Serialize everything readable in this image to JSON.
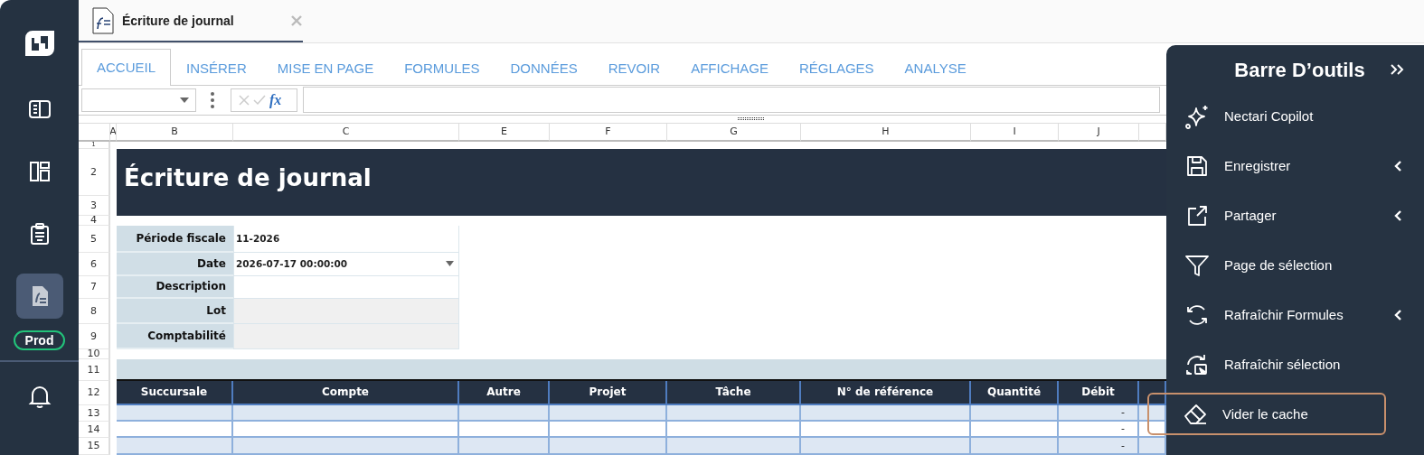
{
  "sidebar": {
    "items": [
      {
        "kind": "panel",
        "selected": false
      },
      {
        "kind": "dashboard",
        "selected": false
      },
      {
        "kind": "clipboard",
        "selected": false
      },
      {
        "kind": "document",
        "selected": true
      }
    ],
    "environment_badge": "Prod"
  },
  "document_tab": {
    "title": "Écriture de journal"
  },
  "ribbon_tabs": [
    {
      "label": "ACCUEIL",
      "selected": true
    },
    {
      "label": "INSÉRER",
      "selected": false
    },
    {
      "label": "MISE EN PAGE",
      "selected": false
    },
    {
      "label": "FORMULES",
      "selected": false
    },
    {
      "label": "DONNÉES",
      "selected": false
    },
    {
      "label": "REVOIR",
      "selected": false
    },
    {
      "label": "AFFICHAGE",
      "selected": false
    },
    {
      "label": "RÉGLAGES",
      "selected": false
    },
    {
      "label": "ANALYSE",
      "selected": false
    }
  ],
  "formula_bar": {
    "function_label": "fx"
  },
  "sheet": {
    "column_headers": [
      "A",
      "B",
      "C",
      "E",
      "F",
      "G",
      "H",
      "I",
      "J"
    ],
    "row_numbers": [
      "1",
      "2",
      "3",
      "4",
      "5",
      "6",
      "7",
      "8",
      "9",
      "10",
      "11",
      "12",
      "13",
      "14",
      "15"
    ],
    "title": "Écriture de journal",
    "fields": [
      {
        "label": "Période fiscale",
        "value": "11-2026",
        "kind": "text",
        "disabled": false
      },
      {
        "label": "Date",
        "value": "2026-07-17 00:00:00",
        "kind": "dropdown",
        "disabled": false
      },
      {
        "label": "Description",
        "kind": "text",
        "disabled": false
      },
      {
        "label": "Lot",
        "kind": "text",
        "disabled": true
      },
      {
        "label": "Comptabilité",
        "kind": "text",
        "disabled": true
      }
    ],
    "table": {
      "columns": [
        "Succursale",
        "Compte",
        "Autre",
        "Projet",
        "Tâche",
        "N° de référence",
        "Quantité",
        "Débit"
      ],
      "rows": [
        {
          "debit": "-"
        },
        {
          "debit": "-"
        },
        {
          "debit": "-"
        }
      ]
    }
  },
  "toolbar": {
    "title": "Barre D’outils",
    "items": [
      {
        "label": "Nectari Copilot",
        "kind": "sparkle",
        "has_submenu": false,
        "selected": false
      },
      {
        "label": "Enregistrer",
        "kind": "save",
        "has_submenu": true,
        "selected": false
      },
      {
        "label": "Partager",
        "kind": "share",
        "has_submenu": true,
        "selected": false
      },
      {
        "label": "Page de sélection",
        "kind": "filter",
        "has_submenu": false,
        "selected": false
      },
      {
        "label": "Rafraîchir Formules",
        "kind": "refresh",
        "has_submenu": true,
        "selected": false
      },
      {
        "label": "Rafraîchir sélection",
        "kind": "refresh-selection",
        "has_submenu": false,
        "selected": false
      },
      {
        "label": "Vider le cache",
        "kind": "eraser",
        "has_submenu": false,
        "selected": true
      }
    ]
  }
}
